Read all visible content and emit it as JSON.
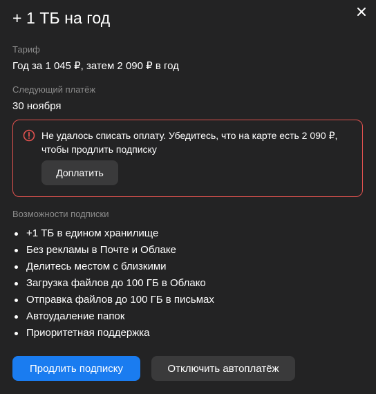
{
  "dialog": {
    "title": "+ 1 ТБ на год",
    "close_icon": "close-icon"
  },
  "tariff": {
    "label": "Тариф",
    "value": "Год за 1 045 ₽, затем 2 090 ₽ в год"
  },
  "next_payment": {
    "label": "Следующий платёж",
    "value": "30 ноября"
  },
  "alert": {
    "icon": "error-icon",
    "text": "Не удалось списать оплату. Убедитесь, что на карте есть 2 090 ₽, чтобы продлить подписку",
    "button_label": "Доплатить",
    "border_color": "#e2524f"
  },
  "features": {
    "label": "Возможности подписки",
    "items": [
      "+1 ТБ в едином хранилище",
      "Без рекламы в Почте и Облаке",
      "Делитесь местом с близкими",
      "Загрузка файлов до 100 ГБ в Облако",
      "Отправка файлов до 100 ГБ в письмах",
      "Автоудаление папок",
      "Приоритетная поддержка"
    ]
  },
  "actions": {
    "primary_label": "Продлить подписку",
    "secondary_label": "Отключить автоплатёж",
    "primary_color": "#1a7cf0"
  }
}
